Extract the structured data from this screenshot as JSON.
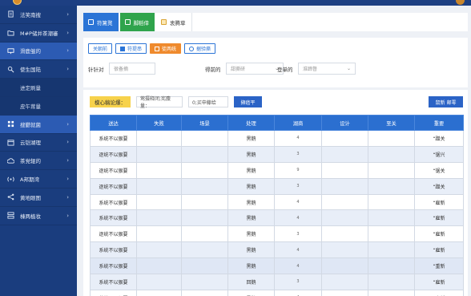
{
  "sidebar": {
    "items": [
      {
        "label": "法笑南搜",
        "icon": "document-icon",
        "chev": true
      },
      {
        "label": "M#P储并茶潮審",
        "icon": "folder-icon",
        "chev": true
      },
      {
        "label": "滑鹿皱的",
        "icon": "monitor-icon",
        "chev": true,
        "active": true
      },
      {
        "label": "使生国陆",
        "icon": "wrench-icon",
        "chev": true
      },
      {
        "label": "进定刷量",
        "sub": true
      },
      {
        "label": "皮午茸量",
        "sub": true
      },
      {
        "label": "搜鬱就菌",
        "icon": "grid-icon",
        "chev": true,
        "active": true
      },
      {
        "label": "云铠湖理",
        "icon": "calendar-icon",
        "chev": true
      },
      {
        "label": "茶党辊的",
        "icon": "cloud-icon",
        "chev": true
      },
      {
        "label": "A邦期湾",
        "icon": "signal-icon",
        "chev": true
      },
      {
        "label": "黄地眼图",
        "icon": "share-icon",
        "chev": true
      },
      {
        "label": "棟两植妆",
        "icon": "server-icon",
        "chev": true
      }
    ]
  },
  "tabs": [
    {
      "label": "符篱凳",
      "style": "blue"
    },
    {
      "label": "脚稻倖",
      "style": "green"
    },
    {
      "label": "衷腾草",
      "style": "plain"
    }
  ],
  "buttons": {
    "b1": "关朝前",
    "b2": "符提串",
    "b3": "徒两统",
    "b4": "据验撕"
  },
  "filters": {
    "f1_label": "针针对",
    "f1_placeholder": "很备摘",
    "f2_label": "得前的",
    "f2_placeholder": "甜撕研",
    "f3_label": "登单的",
    "f3_placeholder": "淮蹄督"
  },
  "toolbar2": {
    "tag": "模心稿论爆：",
    "box1": "莺摄释闭;宪麋量：",
    "box2": "0;买申藤给",
    "btn1": "撷癌平",
    "btn2": "鼠新 邮零"
  },
  "table": {
    "headers": [
      "送达",
      "失败",
      "场景",
      "处理",
      "湖商",
      "设计",
      "至关",
      "重要"
    ],
    "rows": [
      [
        "系统不以狠要",
        "",
        "",
        "黑鹅",
        "4",
        "",
        "",
        "“蹭关"
      ],
      [
        "逐统不以狠要",
        "",
        "",
        "黑鹅",
        "3",
        "",
        "",
        "“锯兴"
      ],
      [
        "逐统不以狠要",
        "",
        "",
        "黑鹅",
        "9",
        "",
        "",
        "“锯关"
      ],
      [
        "逐统不以狠要",
        "",
        "",
        "黑鹅",
        "3",
        "",
        "",
        "“蹭关"
      ],
      [
        "系统不以狠要",
        "",
        "",
        "黑鹅",
        "4",
        "",
        "",
        "“雇新"
      ],
      [
        "系统不以狠要",
        "",
        "",
        "黑鹅",
        "4",
        "",
        "",
        "“雇新"
      ],
      [
        "逐统不以狠要",
        "",
        "",
        "黑鹅",
        "3",
        "",
        "",
        "“雇新"
      ],
      [
        "系统不以狠要",
        "",
        "",
        "黑鹅",
        "4",
        "",
        "",
        "“雇新"
      ],
      [
        "系统不以狠要",
        "",
        "",
        "黑鹅",
        "4",
        "",
        "",
        "“重新"
      ],
      [
        "系统不以狠要",
        "",
        "",
        "回鹅",
        "3",
        "",
        "",
        "“雇新"
      ],
      [
        "苯统不以狠要",
        "",
        "",
        "黑鹅",
        "4",
        "",
        "",
        "“雇新"
      ]
    ]
  }
}
